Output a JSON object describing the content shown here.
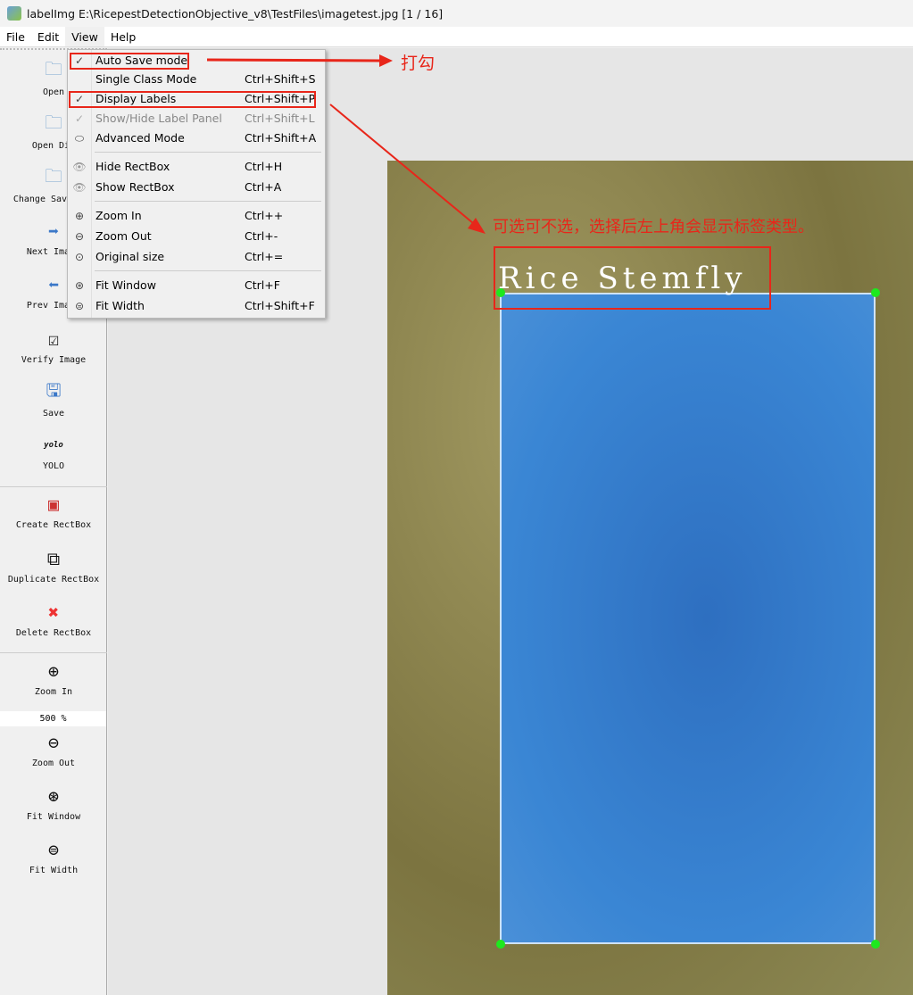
{
  "window": {
    "title": "labelImg E:\\RicepestDetectionObjective_v8\\TestFiles\\imagetest.jpg [1 / 16]"
  },
  "menubar": [
    "File",
    "Edit",
    "View",
    "Help"
  ],
  "toolbar": [
    {
      "label": "Open",
      "icon": "folder-icon"
    },
    {
      "label": "Open Dir",
      "icon": "folder-icon"
    },
    {
      "label": "Change Save Dir",
      "icon": "folder-icon"
    },
    {
      "label": "Next Image",
      "icon": "arrow-right-icon"
    },
    {
      "label": "Prev Image",
      "icon": "arrow-left-icon"
    },
    {
      "label": "Verify Image",
      "icon": "checkbox-icon"
    },
    {
      "label": "Save",
      "icon": "floppy-icon"
    },
    {
      "label": "YOLO",
      "icon": "yolo-icon",
      "icon_text": "yolo"
    },
    {
      "label": "Create RectBox",
      "icon": "create-rect-icon"
    },
    {
      "label": "Duplicate RectBox",
      "icon": "duplicate-icon"
    },
    {
      "label": "Delete RectBox",
      "icon": "delete-icon"
    },
    {
      "label": "Zoom In",
      "icon": "zoom-in-icon"
    },
    {
      "label": "Zoom Out",
      "icon": "zoom-out-icon"
    },
    {
      "label": "Fit Window",
      "icon": "fit-window-icon"
    },
    {
      "label": "Fit Width",
      "icon": "fit-width-icon"
    }
  ],
  "zoom_value": "500 %",
  "view_menu": [
    {
      "label": "Auto Save mode",
      "shortcut": "",
      "checked": true
    },
    {
      "label": "Single Class Mode",
      "shortcut": "Ctrl+Shift+S"
    },
    {
      "label": "Display Labels",
      "shortcut": "Ctrl+Shift+P",
      "checked": true
    },
    {
      "label": "Show/Hide Label Panel",
      "shortcut": "Ctrl+Shift+L",
      "checked": true,
      "disabled": true
    },
    {
      "label": "Advanced Mode",
      "shortcut": "Ctrl+Shift+A"
    },
    {
      "label": "Hide RectBox",
      "shortcut": "Ctrl+H"
    },
    {
      "label": "Show RectBox",
      "shortcut": "Ctrl+A"
    },
    {
      "label": "Zoom In",
      "shortcut": "Ctrl++"
    },
    {
      "label": "Zoom Out",
      "shortcut": "Ctrl+-"
    },
    {
      "label": "Original size",
      "shortcut": "Ctrl+="
    },
    {
      "label": "Fit Window",
      "shortcut": "Ctrl+F"
    },
    {
      "label": "Fit Width",
      "shortcut": "Ctrl+Shift+F"
    }
  ],
  "canvas": {
    "box_label": "Rice Stemfly"
  },
  "annotations": {
    "tick_note": "打勾",
    "label_note": "可选可不选，选择后左上角会显示标签类型。",
    "color": "#e8261a"
  }
}
